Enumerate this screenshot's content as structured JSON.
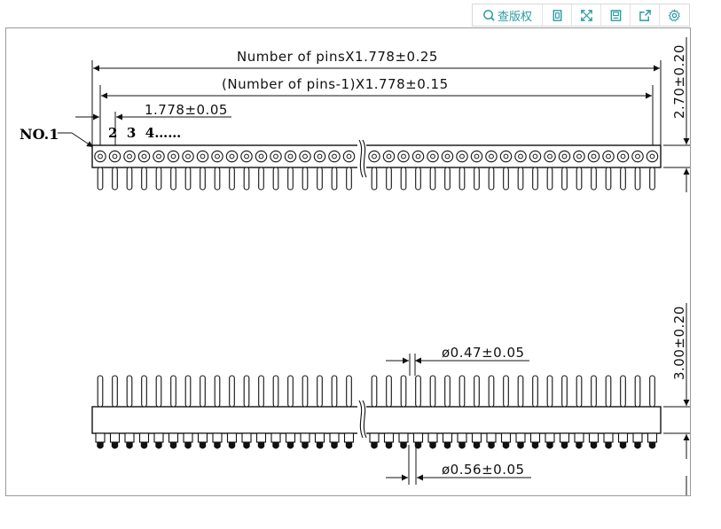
{
  "toolbar": {
    "view_copyright_label": "查版权",
    "icons": [
      "zoom-icon",
      "copy-icon",
      "fullscreen-icon",
      "save-icon",
      "share-icon",
      "settings-icon"
    ],
    "accent_color": "#2b9ba3"
  },
  "drawing": {
    "dim_total_length": "Number of pinsX1.778±0.25",
    "dim_span_length": "(Number of pins-1)X1.778±0.15",
    "dim_pitch": "1.778±0.05",
    "label_pin1": "NO.1",
    "label_pins_seq": "2  3  4……",
    "dim_body_height": "2.70±0.20",
    "dim_pin_top_length": "3.00±0.20",
    "dim_pin_top_dia": "ø0.47±0.05",
    "dim_pin_bottom_dia": "ø0.56±0.05"
  }
}
